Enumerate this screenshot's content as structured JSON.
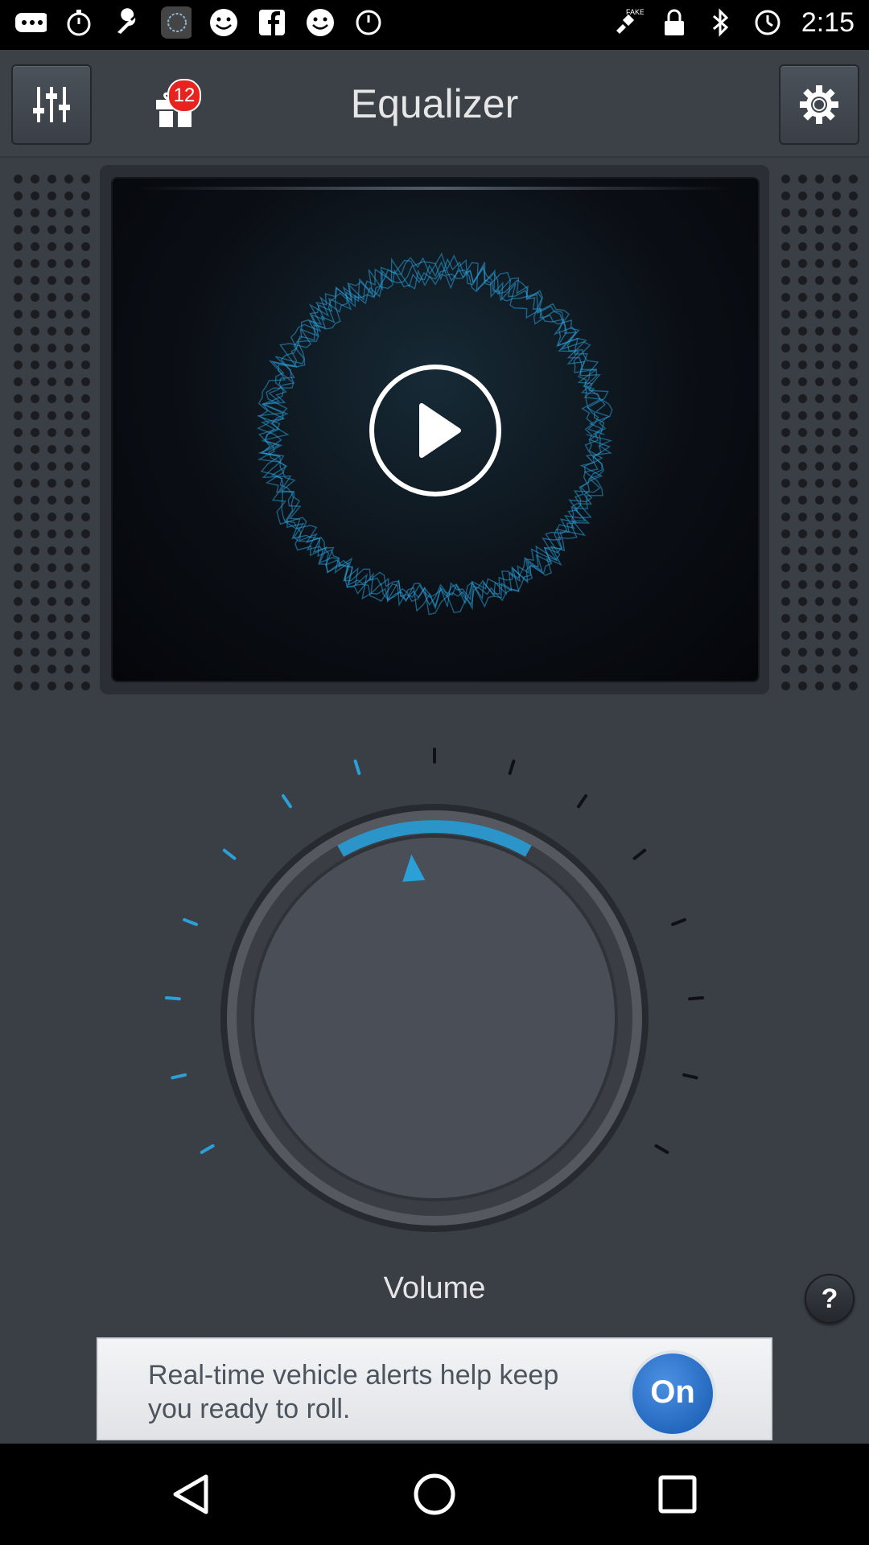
{
  "status_bar": {
    "time": "2:15",
    "left_icons": [
      "more-icon",
      "stopwatch-icon",
      "wrench-icon",
      "app-icon",
      "smiley-icon",
      "facebook-icon",
      "smiley-icon",
      "alarm-icon"
    ],
    "right_icons": [
      "gps-fake-icon",
      "lock-icon",
      "bluetooth-icon",
      "alarm-icon"
    ]
  },
  "header": {
    "title": "Equalizer",
    "gift_badge": "12"
  },
  "visualizer": {
    "accent": "#2a9fd8"
  },
  "dial": {
    "label": "Volume",
    "accent": "#2a9fd8",
    "level_fraction": 0.42
  },
  "help": {
    "label": "?"
  },
  "ad": {
    "text": "Real-time vehicle alerts help keep you ready to roll.",
    "logo_text": "On"
  }
}
